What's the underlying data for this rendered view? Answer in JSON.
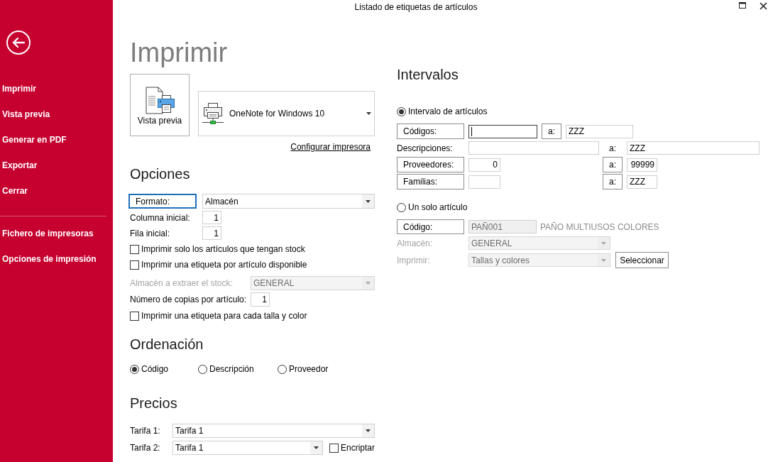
{
  "window": {
    "title": "Listado de etiquetas de artículos"
  },
  "sidebar": {
    "sections": [
      {
        "items": [
          {
            "label": "Imprimir"
          },
          {
            "label": "Vista previa"
          },
          {
            "label": "Generar en PDF"
          },
          {
            "label": "Exportar"
          },
          {
            "label": "Cerrar"
          }
        ]
      },
      {
        "items": [
          {
            "label": "Fichero de impresoras"
          },
          {
            "label": "Opciones de impresión"
          }
        ]
      }
    ]
  },
  "page_title": "Imprimir",
  "printing": {
    "preview_button": "Vista previa",
    "printer": "OneNote for Windows 10",
    "setup_link": "Configurar impresora"
  },
  "options": {
    "heading": "Opciones",
    "format": {
      "label": "Formato:",
      "value": "Almacén",
      "highlighted": true
    },
    "start_column": {
      "label": "Columna inicial:",
      "value": "1"
    },
    "start_row": {
      "label": "Fila inicial:",
      "value": "1"
    },
    "only_in_stock": {
      "label": "Imprimir solo los artículos que tengan stock",
      "checked": false
    },
    "one_per_available": {
      "label": "Imprimir una etiqueta por artículo disponible",
      "checked": false
    },
    "stock_warehouse": {
      "label": "Almacén a extraer el stock:",
      "value": "GENERAL",
      "disabled": true
    },
    "copies": {
      "label": "Número de copias por artículo:",
      "value": "1"
    },
    "per_size_color": {
      "label": "Imprimir una etiqueta para cada talla y color",
      "checked": false
    }
  },
  "ordering": {
    "heading": "Ordenación",
    "options": [
      {
        "label": "Código",
        "selected": true
      },
      {
        "label": "Descripción",
        "selected": false
      },
      {
        "label": "Proveedor",
        "selected": false
      }
    ]
  },
  "prices": {
    "heading": "Precios",
    "rates": [
      {
        "label": "Tarifa 1:",
        "value": "Tarifa 1"
      },
      {
        "label": "Tarifa 2:",
        "value": "Tarifa 1"
      }
    ],
    "encrypt": {
      "label": "Encriptar",
      "checked": false
    }
  },
  "intervals": {
    "heading": "Intervalos",
    "range_mode": {
      "label": "Intervalo de artículos",
      "selected": true
    },
    "range_rows": [
      {
        "kind": "code",
        "label": "Códigos:",
        "from_focused": true,
        "to_label": "a:",
        "to": "ZZZ"
      },
      {
        "kind": "text",
        "label": "Descripciones:",
        "from_focused": false,
        "to_label": "a:",
        "to": "ZZZ"
      },
      {
        "kind": "number",
        "label": "Proveedores:",
        "from": "0",
        "from_focused": false,
        "to_label": "a:",
        "to": "99999"
      },
      {
        "kind": "short",
        "label": "Familias:",
        "from_focused": false,
        "to_label": "a:",
        "to": "ZZZ"
      }
    ],
    "single_mode": {
      "label": "Un solo artículo",
      "selected": false
    },
    "article_code": {
      "label": "Código:",
      "value": "PAÑ001",
      "description": "PAÑO MULTIUSOS COLORES",
      "disabled": true
    },
    "warehouse": {
      "label": "Almacén:",
      "value": "GENERAL",
      "disabled": true
    },
    "print_mode": {
      "label": "Imprimir:",
      "value": "Tallas y colores",
      "disabled": true
    },
    "select_button": "Seleccionar"
  }
}
